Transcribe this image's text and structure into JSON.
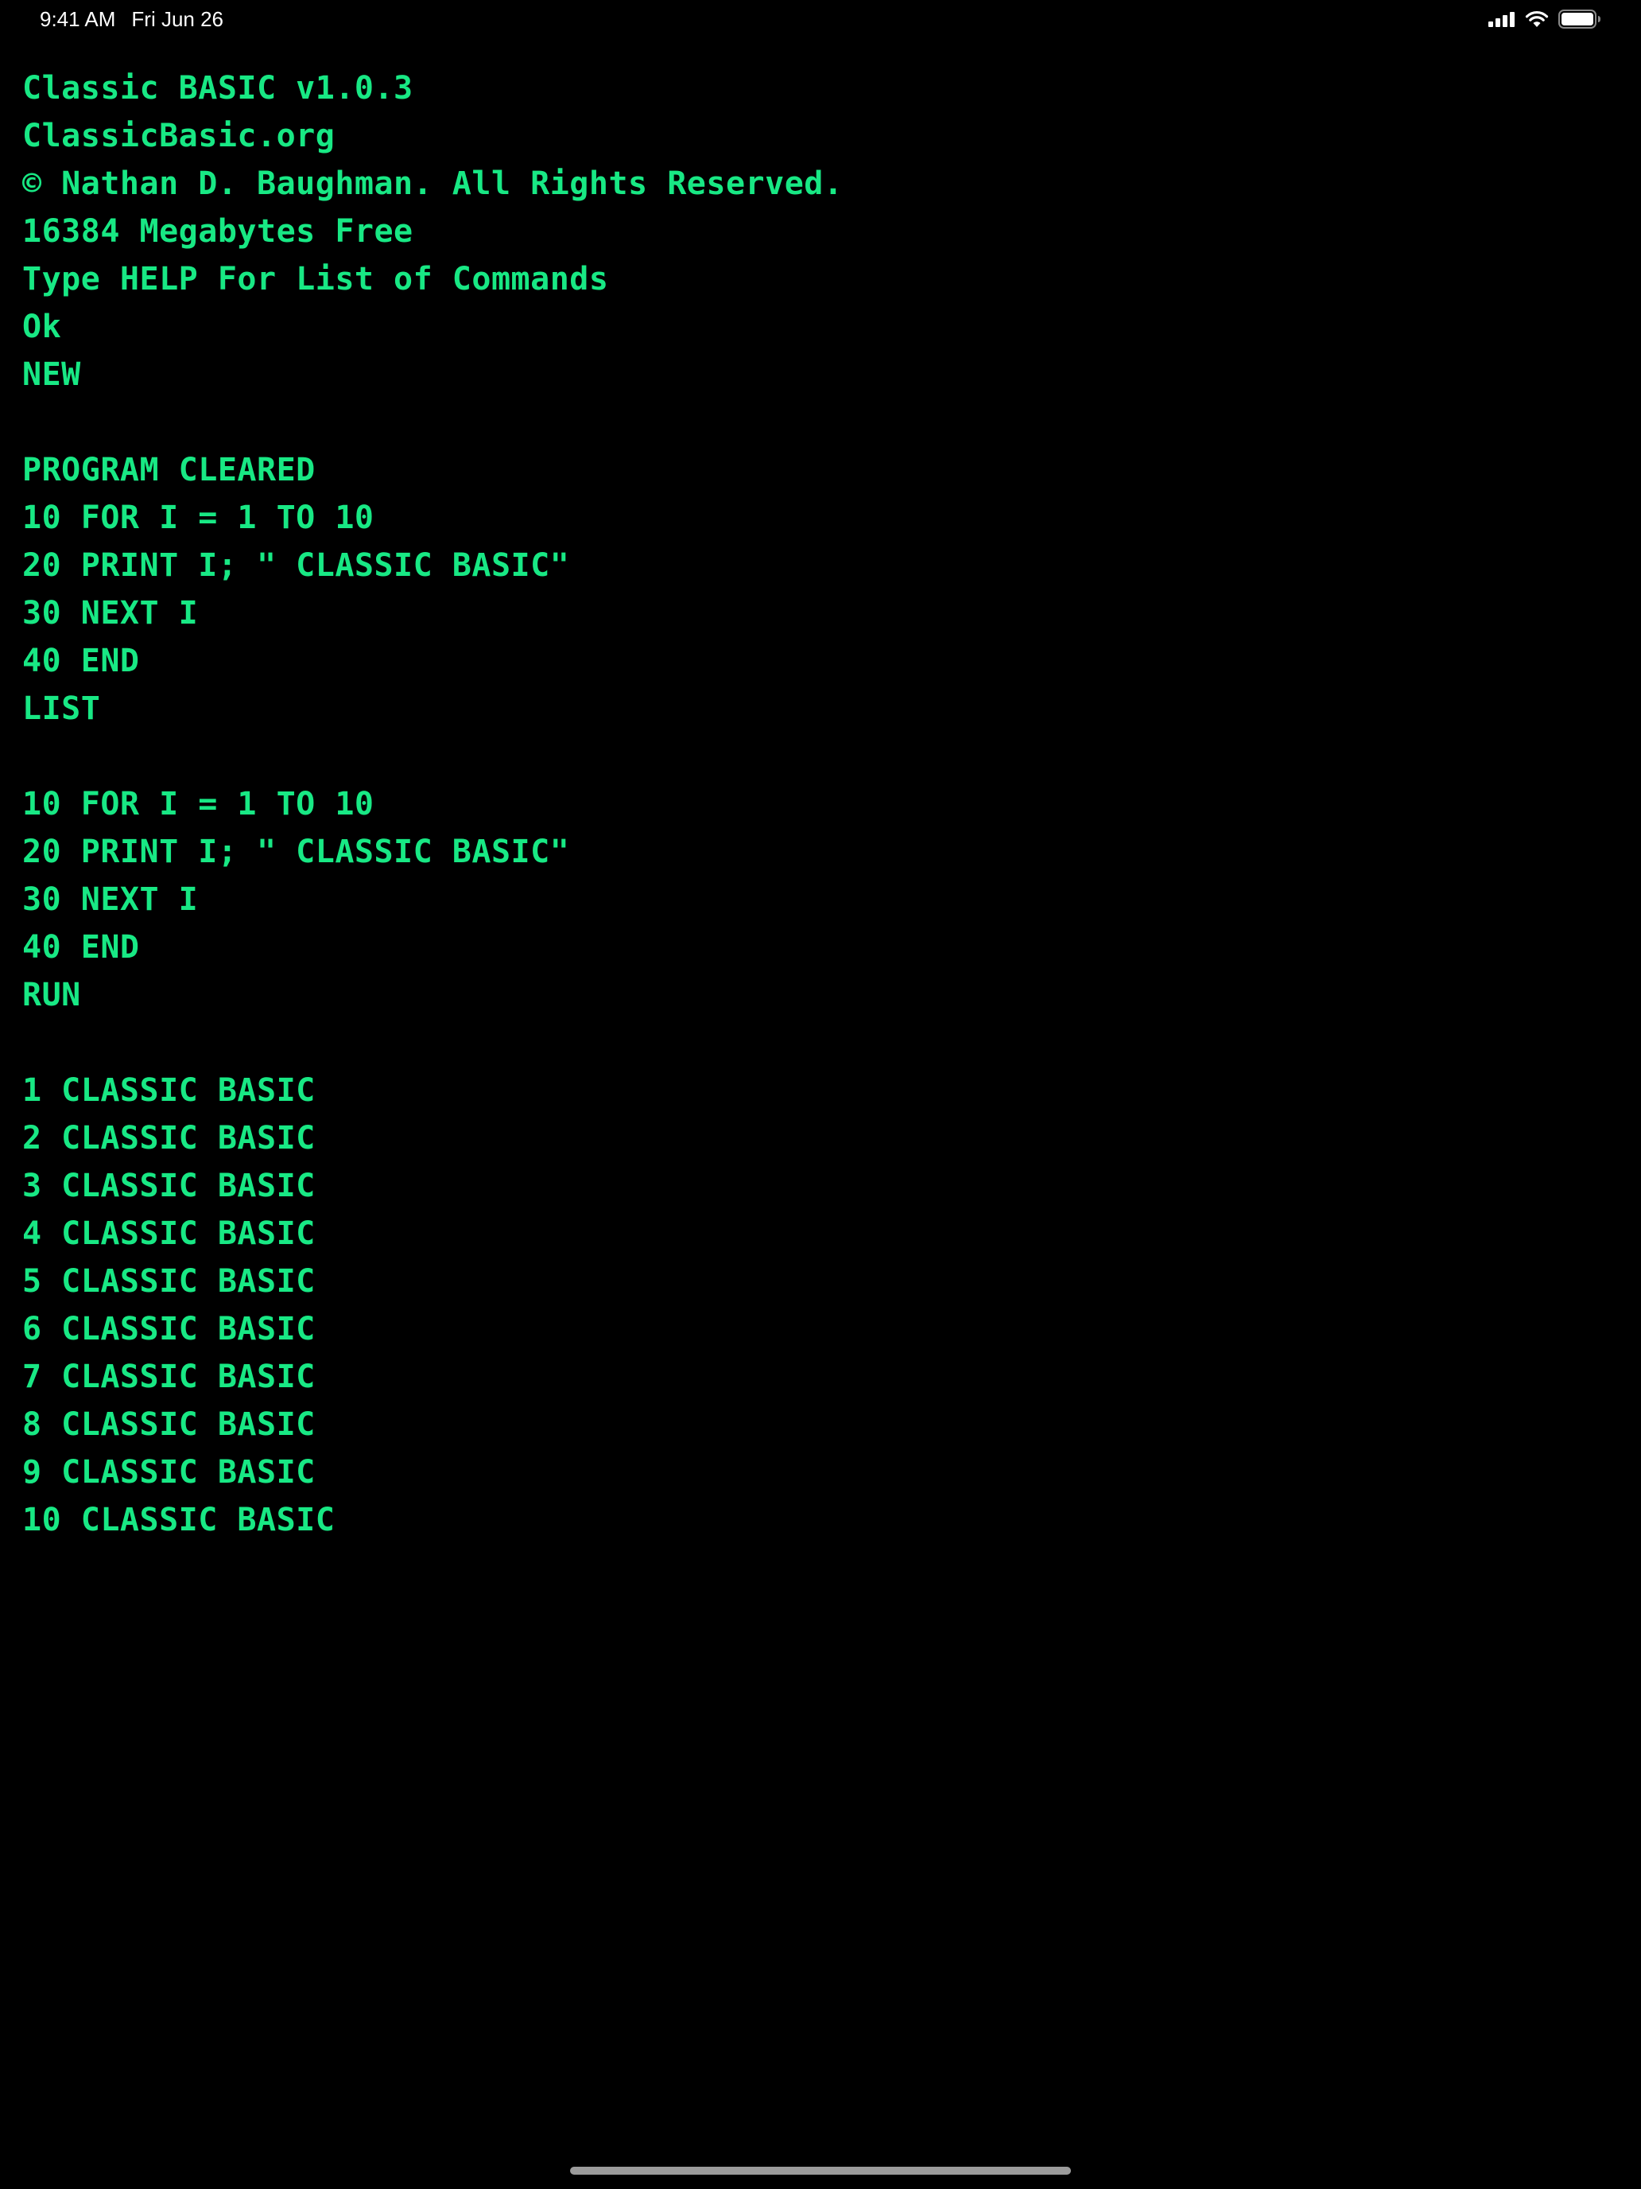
{
  "status_bar": {
    "time": "9:41 AM",
    "date": "Fri Jun 26",
    "icons": [
      "cellular-signal-icon",
      "wifi-icon",
      "battery-icon"
    ]
  },
  "colors": {
    "background": "#000000",
    "terminal_text": "#18e884",
    "status_text": "#ffffff"
  },
  "terminal": {
    "lines": [
      "Classic BASIC v1.0.3",
      "ClassicBasic.org",
      "© Nathan D. Baughman. All Rights Reserved.",
      "16384 Megabytes Free",
      "Type HELP For List of Commands",
      "Ok",
      "NEW",
      "",
      "PROGRAM CLEARED",
      "10 FOR I = 1 TO 10",
      "20 PRINT I; \" CLASSIC BASIC\"",
      "30 NEXT I",
      "40 END",
      "LIST",
      "",
      "10 FOR I = 1 TO 10",
      "20 PRINT I; \" CLASSIC BASIC\"",
      "30 NEXT I",
      "40 END",
      "RUN",
      "",
      "1 CLASSIC BASIC",
      "2 CLASSIC BASIC",
      "3 CLASSIC BASIC",
      "4 CLASSIC BASIC",
      "5 CLASSIC BASIC",
      "6 CLASSIC BASIC",
      "7 CLASSIC BASIC",
      "8 CLASSIC BASIC",
      "9 CLASSIC BASIC",
      "10 CLASSIC BASIC"
    ]
  }
}
